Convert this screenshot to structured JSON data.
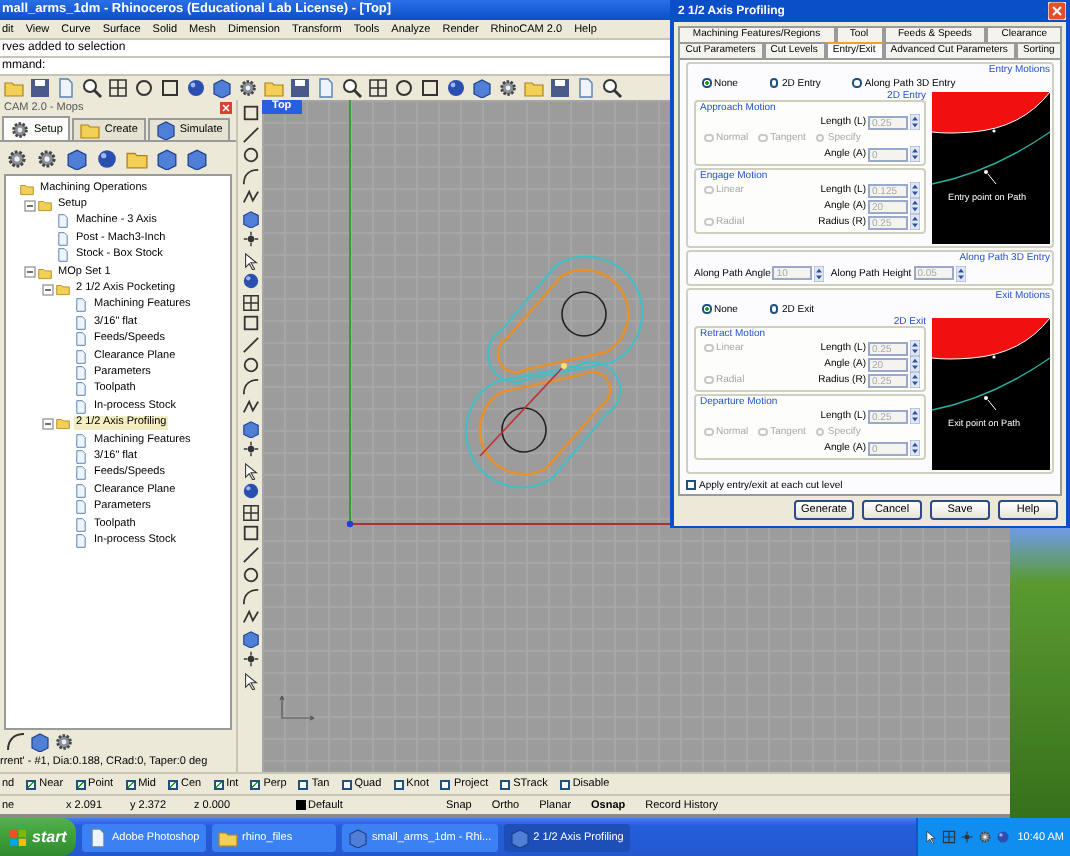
{
  "window": {
    "title": "mall_arms_1dm - Rhinoceros (Educational Lab License) - [Top]"
  },
  "menu": [
    "dit",
    "View",
    "Curve",
    "Surface",
    "Solid",
    "Mesh",
    "Dimension",
    "Transform",
    "Tools",
    "Analyze",
    "Render",
    "RhinoCAM 2.0",
    "Help"
  ],
  "command_history": "rves added to selection",
  "command_prompt": "mmand:",
  "cam_panel": {
    "title": "CAM 2.0 - Mops",
    "tabs": [
      {
        "label": "Setup",
        "selected": true
      },
      {
        "label": "Create",
        "selected": false
      },
      {
        "label": "Simulate",
        "selected": false
      }
    ],
    "tree": [
      {
        "label": "Machining Operations",
        "selected": false,
        "children": [
          {
            "label": "Setup",
            "expanded": true,
            "selected": false,
            "children": [
              {
                "label": "Machine - 3 Axis",
                "selected": false
              },
              {
                "label": "Post - Mach3-Inch",
                "selected": false
              },
              {
                "label": "Stock - Box Stock",
                "selected": false
              }
            ]
          },
          {
            "label": "MOp Set 1",
            "expanded": true,
            "selected": false,
            "children": [
              {
                "label": "2 1/2 Axis Pocketing",
                "expanded": true,
                "selected": false,
                "children": [
                  {
                    "label": "Machining Features",
                    "selected": false
                  },
                  {
                    "label": "3/16\" flat",
                    "selected": false
                  },
                  {
                    "label": "Feeds/Speeds",
                    "selected": false
                  },
                  {
                    "label": "Clearance Plane",
                    "selected": false
                  },
                  {
                    "label": "Parameters",
                    "selected": false
                  },
                  {
                    "label": "Toolpath",
                    "selected": false
                  },
                  {
                    "label": "In-process Stock",
                    "selected": false
                  }
                ]
              },
              {
                "label": "2 1/2 Axis Profiling",
                "expanded": true,
                "selected": true,
                "children": [
                  {
                    "label": "Machining Features",
                    "selected": false
                  },
                  {
                    "label": "3/16\" flat",
                    "selected": false
                  },
                  {
                    "label": "Feeds/Speeds",
                    "selected": false
                  },
                  {
                    "label": "Clearance Plane",
                    "selected": false
                  },
                  {
                    "label": "Parameters",
                    "selected": false
                  },
                  {
                    "label": "Toolpath",
                    "selected": false
                  },
                  {
                    "label": "In-process Stock",
                    "selected": false
                  }
                ]
              }
            ]
          }
        ]
      }
    ],
    "status": "rrent' - #1, Dia:0.188, CRad:0, Taper:0 deg"
  },
  "viewport": {
    "label": "Top"
  },
  "osnaps": [
    {
      "label": "nd",
      "kind": "text"
    },
    {
      "label": "Near",
      "kind": "check",
      "checked": true
    },
    {
      "label": "Point",
      "kind": "check",
      "checked": true
    },
    {
      "label": "Mid",
      "kind": "check",
      "checked": true
    },
    {
      "label": "Cen",
      "kind": "check",
      "checked": true
    },
    {
      "label": "Int",
      "kind": "check",
      "checked": true
    },
    {
      "label": "Perp",
      "kind": "check",
      "checked": true
    },
    {
      "label": "Tan",
      "kind": "check",
      "checked": false
    },
    {
      "label": "Quad",
      "kind": "check",
      "checked": false
    },
    {
      "label": "Knot",
      "kind": "check",
      "checked": false
    },
    {
      "label": "Project",
      "kind": "check",
      "checked": false
    },
    {
      "label": "STrack",
      "kind": "check",
      "checked": false
    },
    {
      "label": "Disable",
      "kind": "check",
      "checked": false
    }
  ],
  "status_bar": {
    "cells": [
      "ne",
      "x 2.091",
      "y 2.372",
      "z 0.000"
    ],
    "layer": "Default",
    "toggles": [
      {
        "label": "Snap",
        "on": false
      },
      {
        "label": "Ortho",
        "on": false
      },
      {
        "label": "Planar",
        "on": false
      },
      {
        "label": "Osnap",
        "on": true
      },
      {
        "label": "Record History",
        "on": false
      }
    ]
  },
  "dialog": {
    "title": "2 1/2 Axis Profiling",
    "tab_rows": [
      [
        {
          "label": "Machining Features/Regions",
          "selected": false
        },
        {
          "label": "Tool",
          "selected": false
        },
        {
          "label": "Feeds & Speeds",
          "selected": false
        },
        {
          "label": "Clearance",
          "selected": false
        }
      ],
      [
        {
          "label": "Cut Parameters",
          "selected": false
        },
        {
          "label": "Cut Levels",
          "selected": false
        },
        {
          "label": "Entry/Exit",
          "selected": true
        },
        {
          "label": "Advanced Cut Parameters",
          "selected": false
        },
        {
          "label": "Sorting",
          "selected": false
        }
      ]
    ],
    "entry": {
      "title": "Entry Motions",
      "options": [
        {
          "label": "None",
          "selected": true
        },
        {
          "label": "2D Entry",
          "selected": false
        },
        {
          "label": "Along Path 3D Entry",
          "selected": false
        }
      ],
      "subtitle": "2D Entry",
      "motions": [
        {
          "title": "Approach Motion",
          "disabled": true,
          "rows": [
            {
              "field": {
                "label": "Length (L)",
                "value": "0.25"
              }
            },
            {
              "radios": [
                {
                  "label": "Normal",
                  "selected": false
                },
                {
                  "label": "Tangent",
                  "selected": false
                },
                {
                  "label": "Specify",
                  "selected": false
                }
              ]
            },
            {
              "field": {
                "label": "Angle (A)",
                "value": "0"
              }
            }
          ]
        },
        {
          "title": "Engage Motion",
          "disabled": true,
          "rows": [
            {
              "radios": [
                {
                  "label": "Linear",
                  "selected": false
                }
              ],
              "field": {
                "label": "Length (L)",
                "value": "0.125"
              }
            },
            {
              "field": {
                "label": "Angle (A)",
                "value": "20"
              }
            },
            {
              "radios": [
                {
                  "label": "Radial",
                  "selected": false
                }
              ],
              "field": {
                "label": "Radius (R)",
                "value": "0.25"
              }
            }
          ]
        }
      ],
      "preview_caption": "Entry point on Path"
    },
    "along_path": {
      "title": "Along Path 3D Entry",
      "fields": [
        {
          "label": "Along Path Angle",
          "value": "10"
        },
        {
          "label": "Along Path Height",
          "value": "0.05"
        }
      ]
    },
    "exit": {
      "title": "Exit Motions",
      "options": [
        {
          "label": "None",
          "selected": true
        },
        {
          "label": "2D Exit",
          "selected": false
        }
      ],
      "subtitle": "2D Exit",
      "motions": [
        {
          "title": "Retract Motion",
          "disabled": true,
          "rows": [
            {
              "radios": [
                {
                  "label": "Linear",
                  "selected": false
                }
              ],
              "field": {
                "label": "Length (L)",
                "value": "0.25"
              }
            },
            {
              "field": {
                "label": "Angle (A)",
                "value": "20"
              }
            },
            {
              "radios": [
                {
                  "label": "Radial",
                  "selected": false
                }
              ],
              "field": {
                "label": "Radius (R)",
                "value": "0.25"
              }
            }
          ]
        },
        {
          "title": "Departure Motion",
          "disabled": true,
          "rows": [
            {
              "field": {
                "label": "Length (L)",
                "value": "0.25"
              }
            },
            {
              "radios": [
                {
                  "label": "Normal",
                  "selected": false
                },
                {
                  "label": "Tangent",
                  "selected": false
                },
                {
                  "label": "Specify",
                  "selected": false
                }
              ]
            },
            {
              "field": {
                "label": "Angle (A)",
                "value": "0"
              }
            }
          ]
        }
      ],
      "preview_caption": "Exit point on Path"
    },
    "apply_each_level": {
      "label": "Apply entry/exit at each cut level",
      "checked": false
    },
    "buttons": [
      "Generate",
      "Cancel",
      "Save",
      "Help"
    ]
  },
  "taskbar": {
    "start": "start",
    "items": [
      {
        "label": "Adobe Photoshop",
        "selected": false
      },
      {
        "label": "rhino_files",
        "selected": false
      },
      {
        "label": "small_arms_1dm - Rhi...",
        "selected": false
      },
      {
        "label": "2 1/2 Axis Profiling",
        "selected": true
      }
    ],
    "clock": "10:40 AM"
  }
}
